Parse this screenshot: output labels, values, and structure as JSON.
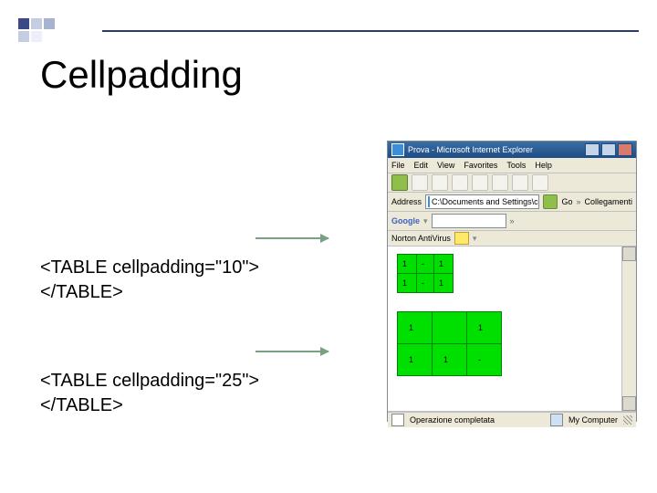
{
  "title": "Cellpadding",
  "code1_l1": "<TABLE cellpadding=\"10\">",
  "code1_l2": "</TABLE>",
  "code2_l1": "<TABLE cellpadding=\"25\">",
  "code2_l2": "</TABLE>",
  "browser": {
    "title": "Prova - Microsoft Internet Explorer",
    "menu": [
      "File",
      "Edit",
      "View",
      "Favorites",
      "Tools",
      "Help"
    ],
    "address_label": "Address",
    "address_value": "C:\\Documents and Settings\\cadoley\\Desktop\\t",
    "address_go": "Go",
    "links_label": "Collegamenti",
    "google_label": "Google",
    "norton_label": "Norton AntiVirus",
    "status_left": "Operazione completata",
    "status_right": "My Computer"
  },
  "cells": {
    "a": "1",
    "b": "-",
    "c": "1",
    "d": "1",
    "e": "-",
    "f": "1"
  },
  "cells2": {
    "a": "1",
    "b": "",
    "c": "1",
    "d": "1",
    "e": "1",
    "f": "-"
  }
}
